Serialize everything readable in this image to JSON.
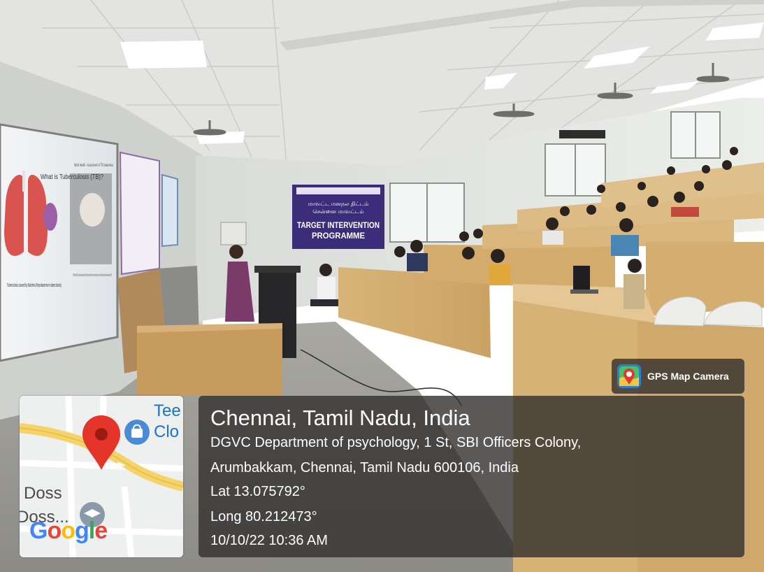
{
  "photo": {
    "slide": {
      "title": "What is Tuberculosis (TB)?",
      "header": "Nikhil Health - Assessment of TB Awareness",
      "caption": "Tuberculosis caused by Bacteria (Mycobacterium tuberculosis)",
      "body": "On 24 March 1882, German physician and Nobel Prize winner Robert Koch announced the discovery of the bacterium that causes tuberculosis (TB)"
    },
    "banner": {
      "line1": "மாவட்ட மனநல திட்டம்",
      "line2": "சென்னை மாவட்டம்",
      "title_line1": "TARGET INTERVENTION",
      "title_line2": "PROGRAMME"
    }
  },
  "map": {
    "labels": {
      "teej": "Tee",
      "clo": "Clo",
      "doss": "Doss",
      "doss2": "Doss..."
    },
    "logo": "Google"
  },
  "location": {
    "place": "Chennai, Tamil Nadu, India",
    "address_line_1": "DGVC Department of psychology, 1 St, SBI Officers Colony,",
    "address_line_2": "Arumbakkam, Chennai, Tamil Nadu 600106, India",
    "lat": "Lat 13.075792°",
    "long": "Long 80.212473°",
    "datetime": "10/10/22 10:36 AM"
  },
  "app": {
    "name": "GPS Map Camera"
  },
  "colors": {
    "overlay": "#32302e",
    "map_pin": "#e4352b",
    "map_road": "#f5d36b",
    "banner": "#3b2d7a"
  }
}
